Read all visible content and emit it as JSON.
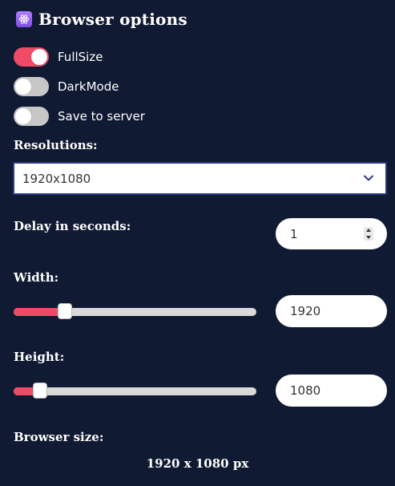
{
  "header": {
    "title": "Browser options",
    "icon": "atom-icon"
  },
  "toggles": [
    {
      "label": "FullSize",
      "on": true
    },
    {
      "label": "DarkMode",
      "on": false
    },
    {
      "label": "Save to server",
      "on": false
    }
  ],
  "resolutions": {
    "label": "Resolutions:",
    "selected": "1920x1080"
  },
  "delay": {
    "label": "Delay in seconds:",
    "value": "1"
  },
  "width": {
    "label": "Width:",
    "value": "1920",
    "slider_fraction": 0.21
  },
  "height": {
    "label": "Height:",
    "value": "1080",
    "slider_fraction": 0.108
  },
  "browser_size": {
    "label": "Browser size:",
    "value": "1920 x 1080 px"
  },
  "colors": {
    "background": "#101a33",
    "accent": "#ef4a66",
    "select_border": "#2f3a8c",
    "icon_purple": "#9a64f5"
  }
}
